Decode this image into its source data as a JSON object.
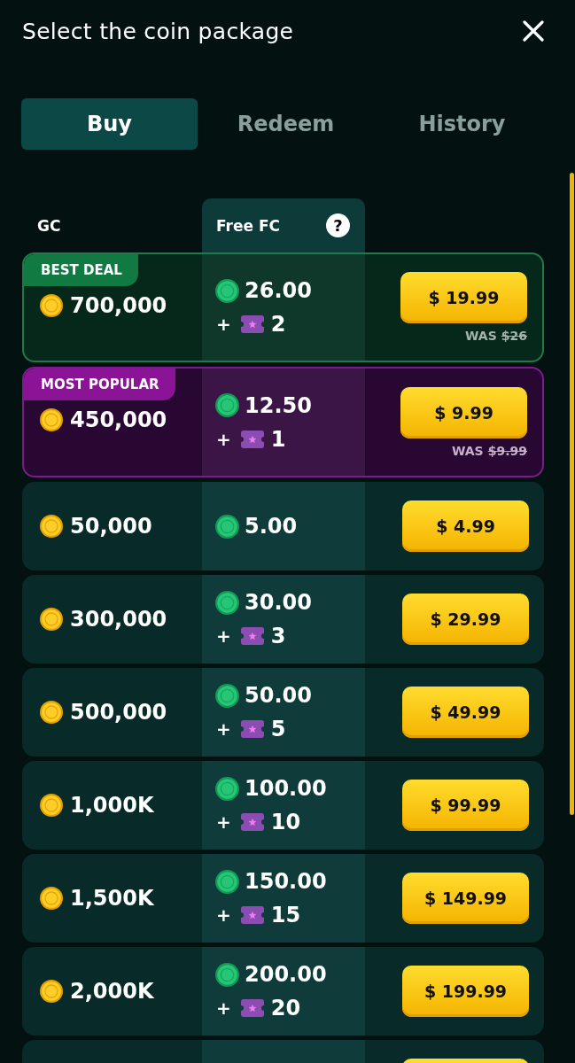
{
  "header": {
    "title": "Select the coin package"
  },
  "tabs": [
    {
      "label": "Buy",
      "selected": true
    },
    {
      "label": "Redeem",
      "selected": false
    },
    {
      "label": "History",
      "selected": false
    }
  ],
  "table": {
    "columns": [
      {
        "kind": "plain",
        "label": "GC"
      },
      {
        "kind": "highlighted",
        "label": "Free FC",
        "help": "?"
      }
    ],
    "rows": [
      {
        "kind": "best_deal",
        "badge": "BEST DEAL",
        "gc": "700,000",
        "fc": "26.00",
        "tickets": {
          "plus": "+",
          "count": "2"
        },
        "price": "$ 19.99",
        "was": {
          "label": "WAS",
          "old_price": "$26"
        }
      },
      {
        "kind": "most_popular",
        "badge": "MOST POPULAR",
        "gc": "450,000",
        "fc": "12.50",
        "tickets": {
          "plus": "+",
          "count": "1"
        },
        "price": "$ 9.99",
        "was": {
          "label": "WAS",
          "old_price": "$9.99"
        }
      },
      {
        "kind": "regular",
        "gc": "50,000",
        "fc": "5.00",
        "price": "$ 4.99"
      },
      {
        "kind": "regular",
        "gc": "300,000",
        "fc": "30.00",
        "tickets": {
          "plus": "+",
          "count": "3"
        },
        "price": "$ 29.99"
      },
      {
        "kind": "regular",
        "gc": "500,000",
        "fc": "50.00",
        "tickets": {
          "plus": "+",
          "count": "5"
        },
        "price": "$ 49.99"
      },
      {
        "kind": "regular",
        "gc": "1,000K",
        "fc": "100.00",
        "tickets": {
          "plus": "+",
          "count": "10"
        },
        "price": "$ 99.99"
      },
      {
        "kind": "regular",
        "gc": "1,500K",
        "fc": "150.00",
        "tickets": {
          "plus": "+",
          "count": "15"
        },
        "price": "$ 149.99"
      },
      {
        "kind": "regular",
        "gc": "2,000K",
        "fc": "200.00",
        "tickets": {
          "plus": "+",
          "count": "20"
        },
        "price": "$ 199.99"
      },
      {
        "kind": "regular"
      }
    ]
  }
}
